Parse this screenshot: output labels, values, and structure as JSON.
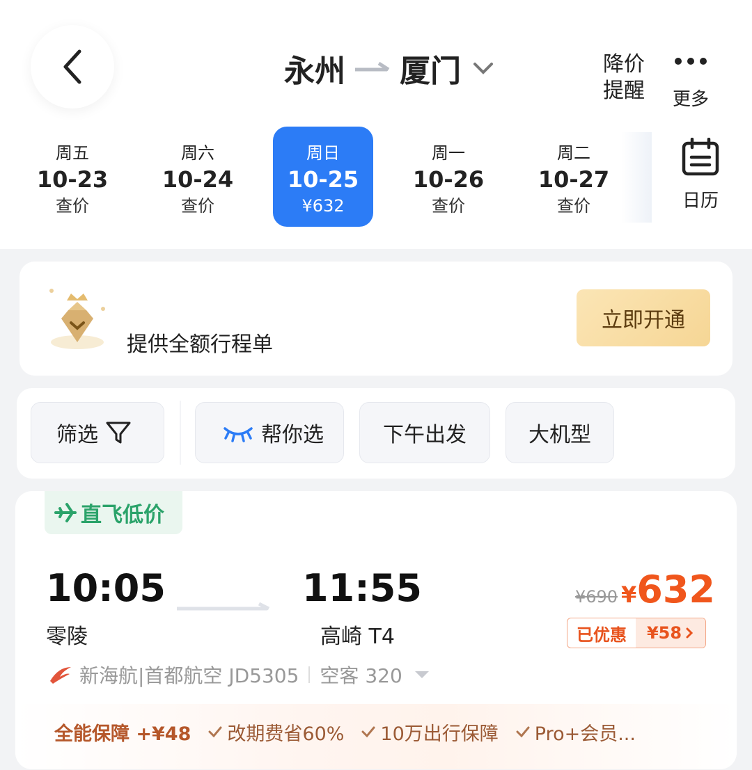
{
  "header": {
    "from_city": "永州",
    "to_city": "厦门",
    "price_alert_line1": "降价",
    "price_alert_line2": "提醒",
    "more_label": "更多"
  },
  "dates": [
    {
      "weekday": "周五",
      "date": "10-23",
      "price": "查价",
      "active": false
    },
    {
      "weekday": "周六",
      "date": "10-24",
      "price": "查价",
      "active": false
    },
    {
      "weekday": "周日",
      "date": "10-25",
      "price": "¥632",
      "active": true
    },
    {
      "weekday": "周一",
      "date": "10-26",
      "price": "查价",
      "active": false
    },
    {
      "weekday": "周二",
      "date": "10-27",
      "price": "查价",
      "active": false
    }
  ],
  "calendar_label": "日历",
  "promo": {
    "text": "提供全额行程单",
    "cta": "立即开通"
  },
  "filters": {
    "filter": "筛选",
    "help_choose": "帮你选",
    "afternoon": "下午出发",
    "big_plane": "大机型"
  },
  "flight": {
    "tag": "直飞低价",
    "dep_time": "10:05",
    "dep_airport": "零陵",
    "arr_time": "11:55",
    "arr_airport": "高崎 T4",
    "old_price": "¥690",
    "currency": "¥",
    "price": "632",
    "discount_label": "已优惠",
    "discount_amount": "¥58",
    "airline": "新海航|首都航空 JD5305",
    "aircraft": "空客 320",
    "benefit_main": "全能保障 +¥48",
    "benefits": [
      "改期费省60%",
      "10万出行保障",
      "Pro+会员..."
    ]
  },
  "colors": {
    "accent_blue": "#2c7cf6",
    "price_orange": "#f0561c",
    "tag_green": "#2ba36a"
  },
  "icons": [
    "back-arrow-icon",
    "route-arrow-icon",
    "chevron-down-icon",
    "more-dots-icon",
    "calendar-icon",
    "crown-badge-icon",
    "filter-funnel-icon",
    "eye-lashes-icon",
    "plane-icon",
    "airline-logo-icon",
    "checkmark-icon"
  ]
}
